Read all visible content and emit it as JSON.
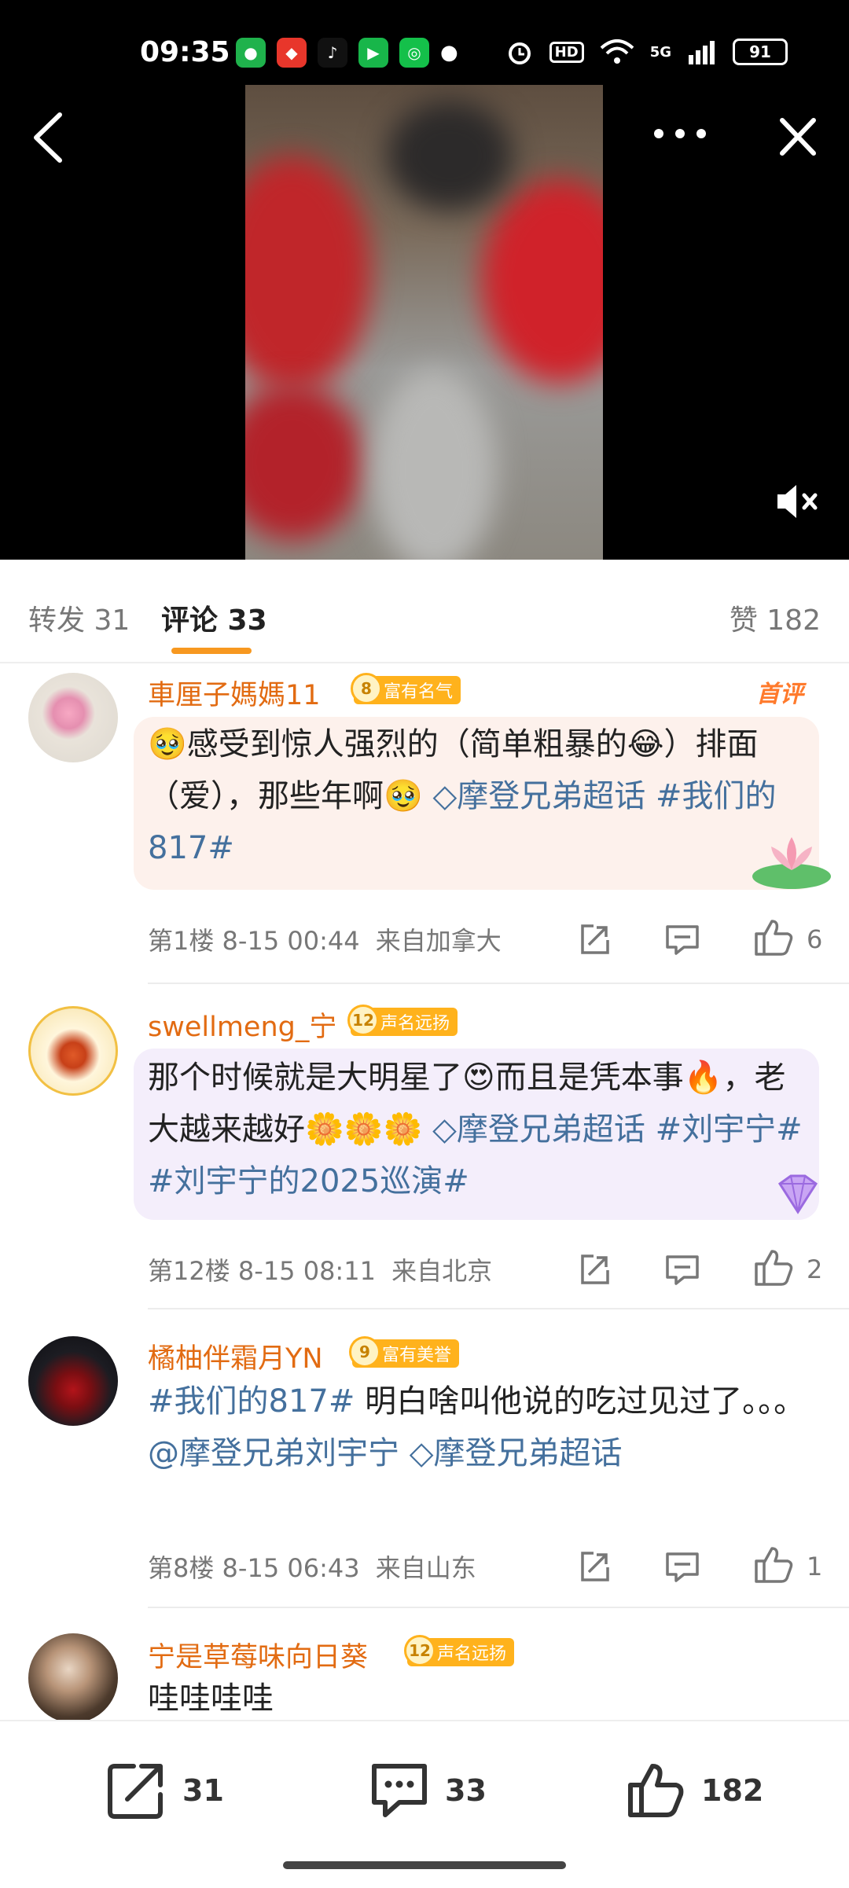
{
  "status": {
    "time": "09:35",
    "battery": "91",
    "network": "5G",
    "hd": "HD"
  },
  "tabs": {
    "forward": "转发 31",
    "comment": "评论 33",
    "like": "赞 182"
  },
  "comments": [
    {
      "user": "車厘子媽媽11",
      "badge_level": "8",
      "badge_text": "富有名气",
      "first_tag": "首评",
      "text_plain_1": "🥹感受到惊人强烈的（简单粗暴的😂）排面 （爱），那些年啊🥹",
      "topic_1": "◇摩登兄弟超话",
      "topic_2": "#我们的817#",
      "floor": "第1楼",
      "time": "8-15 00:44",
      "location": "来自加拿大",
      "likes": "6"
    },
    {
      "user": "swellmeng_宁",
      "badge_level": "12",
      "badge_text": "声名远扬",
      "text_plain_1": "那个时候就是大明星了😍而且是凭本事🔥，老大越来越好🌼🌼🌼",
      "topic_1": "◇摩登兄弟超话",
      "topic_2": "#刘宇宁#",
      "topic_3": "#刘宇宁的2025巡演#",
      "floor": "第12楼",
      "time": "8-15 08:11",
      "location": "来自北京",
      "likes": "2"
    },
    {
      "user": "橘柚伴霜月YN",
      "badge_level": "9",
      "badge_text": "富有美誉",
      "topic_1": "#我们的817#",
      "text_plain_1": "明白啥叫他说的吃过见过了。。。",
      "mention": "@摩登兄弟刘宇宁",
      "topic_2": "◇摩登兄弟超话",
      "floor": "第8楼",
      "time": "8-15 06:43",
      "location": "来自山东",
      "likes": "1"
    },
    {
      "user": "宁是草莓味向日葵",
      "badge_level": "12",
      "badge_text": "声名远扬",
      "text_plain_1": "哇哇哇哇"
    }
  ],
  "bottom_bar": {
    "share_count": "31",
    "comment_count": "33",
    "like_count": "182"
  },
  "colors": {
    "accent": "#f79820",
    "username": "#e26b12",
    "topic": "#44709d",
    "badge": "#ffb21c"
  }
}
